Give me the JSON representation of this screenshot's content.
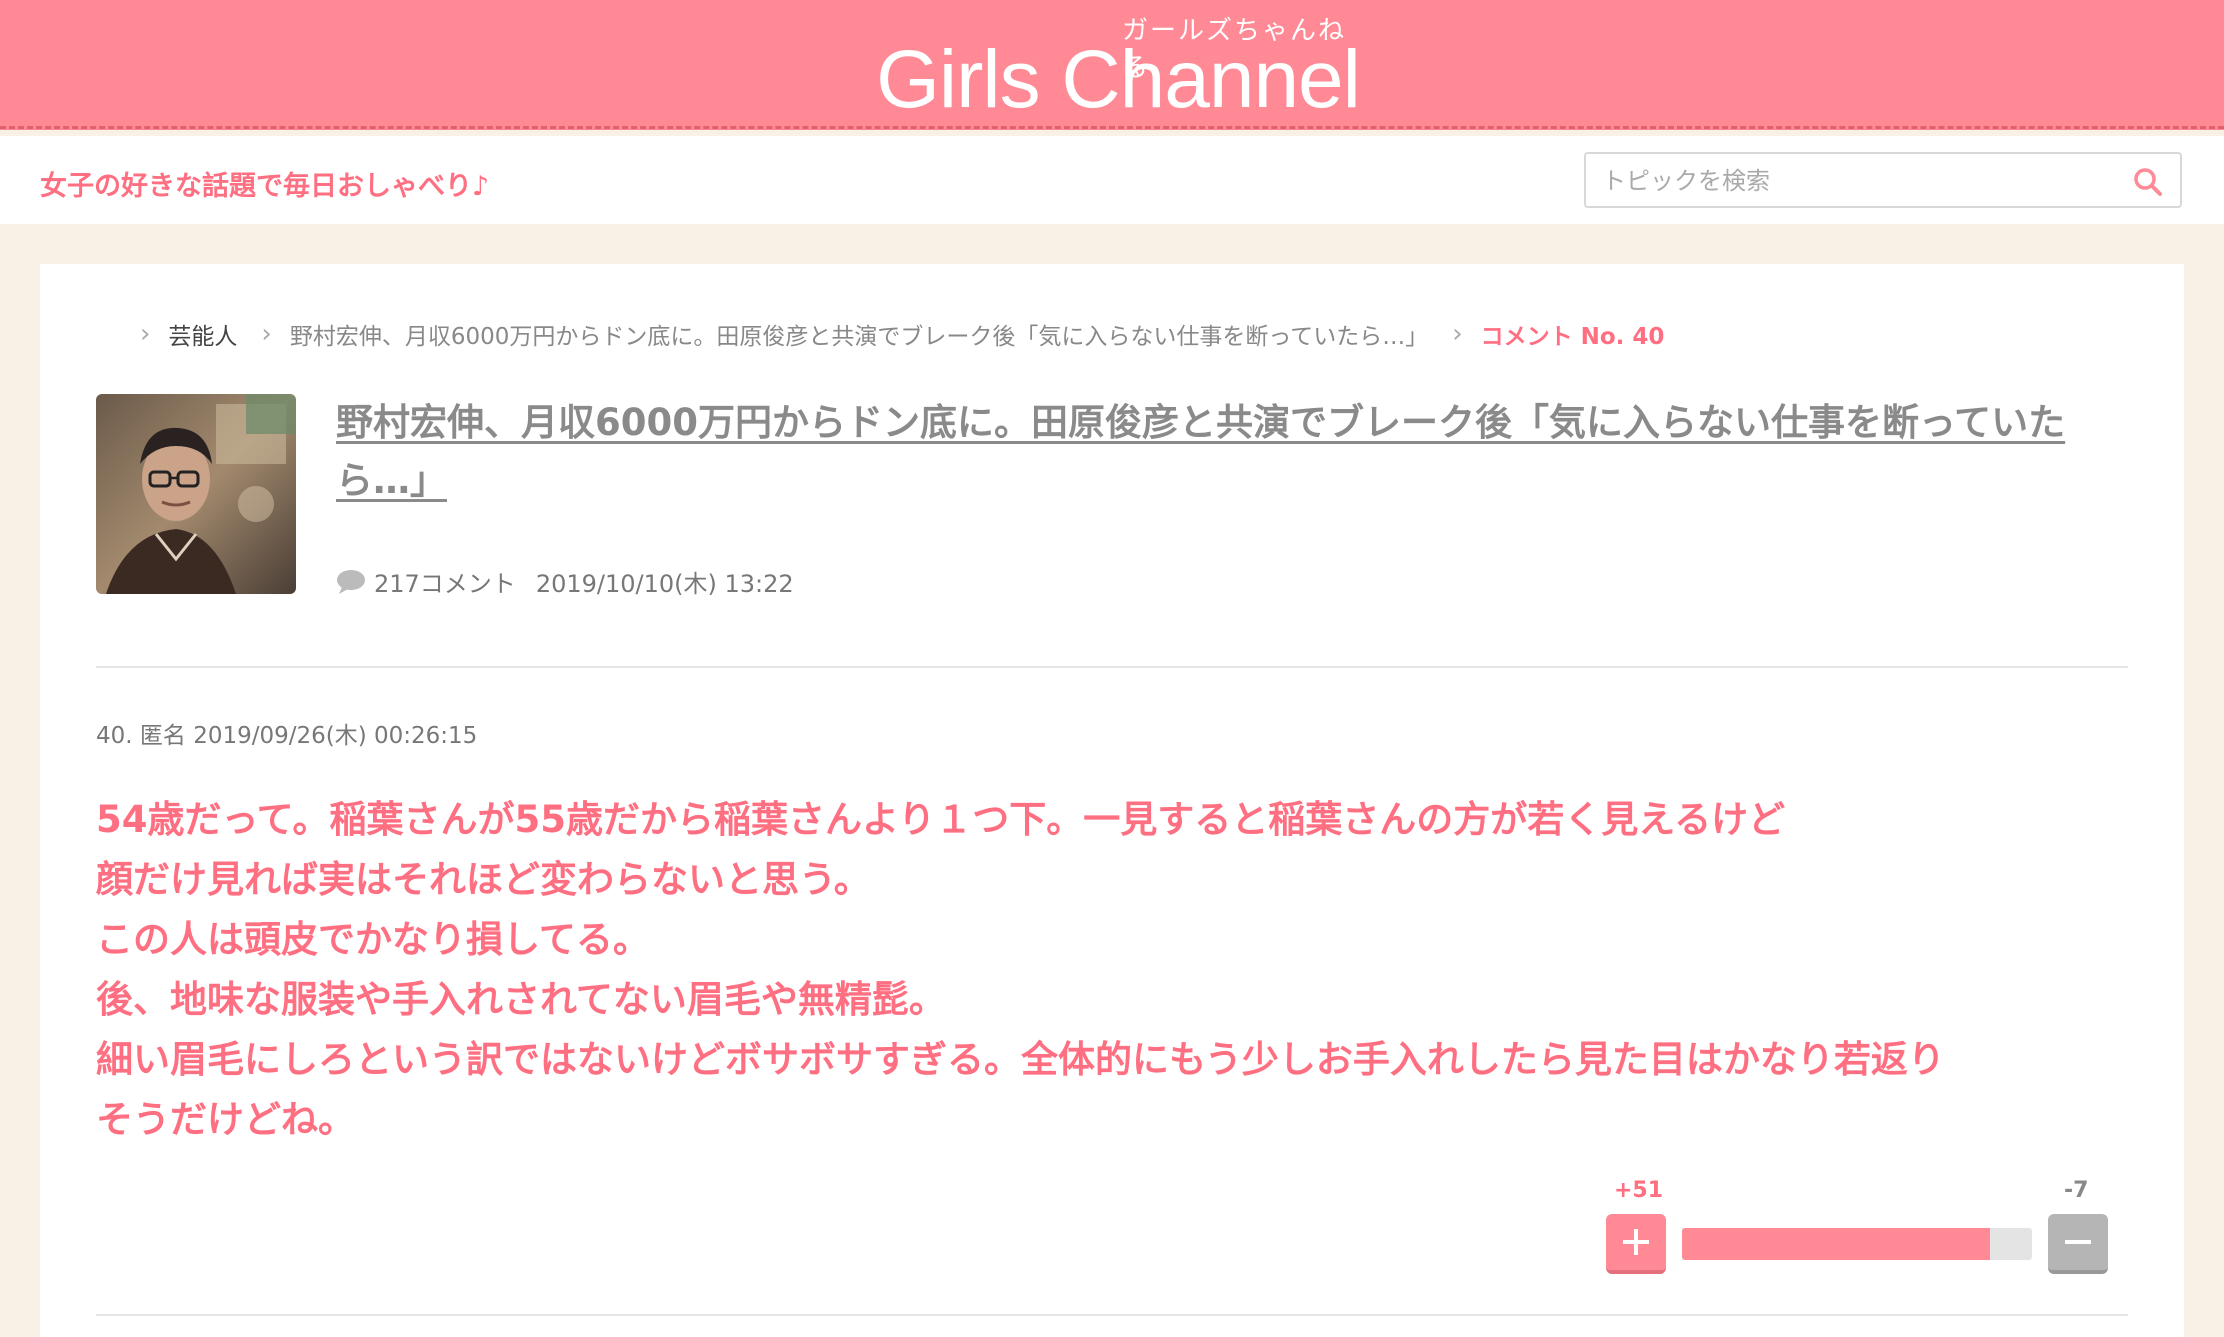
{
  "header": {
    "logo_kana": "ガールズちゃんねる",
    "logo_text": "Girls Channel",
    "tagline": "女子の好きな話題で毎日おしゃべり♪",
    "search_placeholder": "トピックを検索"
  },
  "breadcrumb": {
    "category": "芸能人",
    "topic": "野村宏伸、月収6000万円からドン底に。田原俊彦と共演でブレーク後「気に入らない仕事を断っていたら…」",
    "current": "コメント No. 40"
  },
  "topic": {
    "title": "野村宏伸、月収6000万円からドン底に。田原俊彦と共演でブレーク後「気に入らない仕事を断っていたら…」",
    "comment_count": "217コメント",
    "date": "2019/10/10(木) 13:22"
  },
  "comment": {
    "header": "40. 匿名 2019/09/26(木) 00:26:15",
    "lines": [
      "54歳だって。稲葉さんが55歳だから稲葉さんより１つ下。一見すると稲葉さんの方が若く見えるけど",
      "顔だけ見れば実はそれほど変わらないと思う。",
      "この人は頭皮でかなり損してる。",
      "後、地味な服装や手入れされてない眉毛や無精髭。",
      "細い眉毛にしろという訳ではないけどボサボサすぎる。全体的にもう少しお手入れしたら見た目はかなり若返り",
      "そうだけどね。"
    ],
    "plus_count": "+51",
    "minus_count": "-7",
    "plus_ratio": 0.879
  },
  "colors": {
    "accent": "#ff8a96",
    "accent_text": "#ff6f82"
  },
  "icons": {
    "search": "search-icon",
    "comment": "comment-bubble-icon",
    "chevron": "chevron-right-icon"
  }
}
